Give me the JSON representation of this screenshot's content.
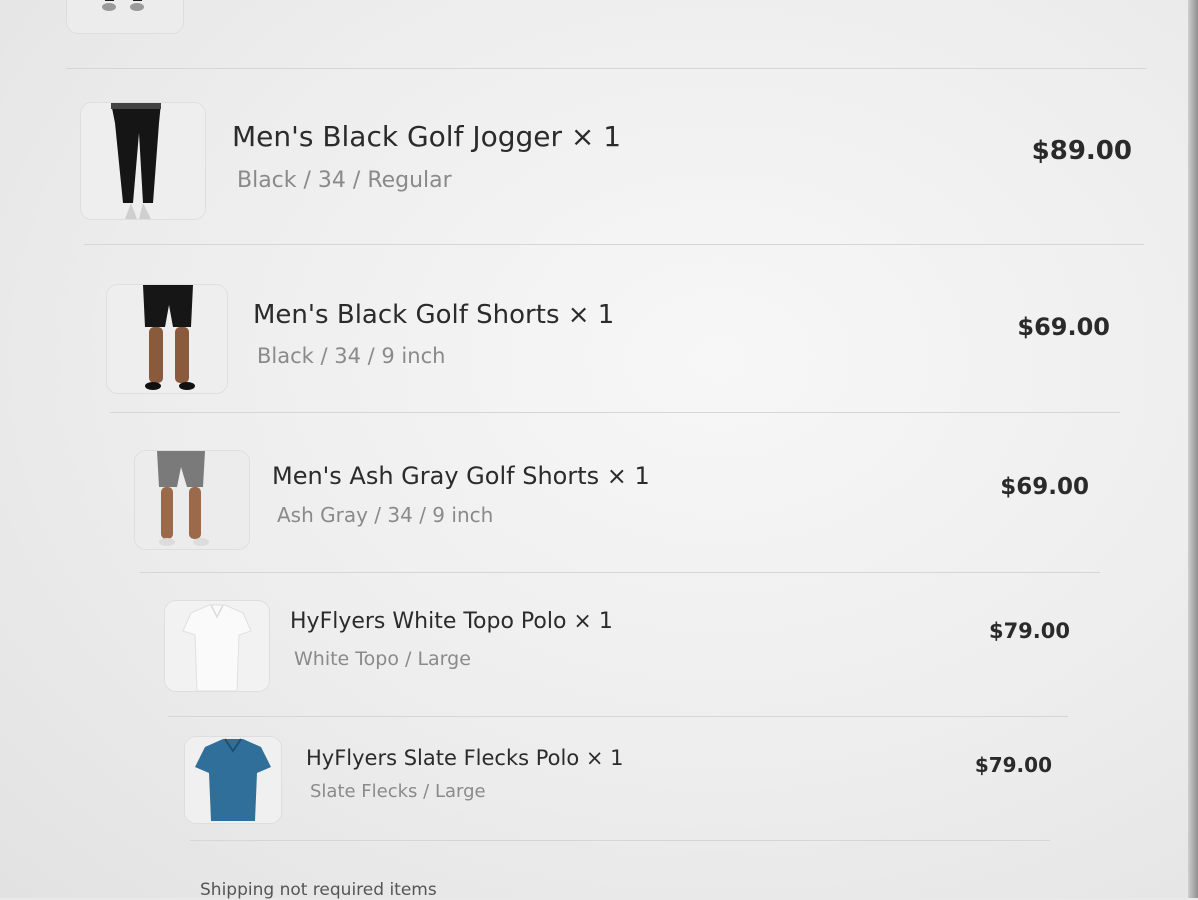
{
  "items": [
    {
      "title": "Men's Black Golf Jogger × 1",
      "variant": "Black / 34 / Regular",
      "price": "$89.00",
      "thumb": "black-jogger-image"
    },
    {
      "title": "Men's Black Golf Shorts × 1",
      "variant": "Black / 34 / 9 inch",
      "price": "$69.00",
      "thumb": "black-shorts-image"
    },
    {
      "title": "Men's Ash Gray Golf Shorts × 1",
      "variant": "Ash Gray / 34 / 9 inch",
      "price": "$69.00",
      "thumb": "ash-gray-shorts-image"
    },
    {
      "title": "HyFlyers White Topo Polo × 1",
      "variant": "White Topo / Large",
      "price": "$79.00",
      "thumb": "white-polo-image"
    },
    {
      "title": "HyFlyers Slate Flecks Polo × 1",
      "variant": "Slate Flecks / Large",
      "price": "$79.00",
      "thumb": "slate-polo-image"
    }
  ],
  "footer": {
    "shipping_label": "Shipping not required items"
  },
  "colors": {
    "slate_polo": "#2f6f9a",
    "text": "#2b2b2b",
    "muted": "#8a8a8a"
  }
}
